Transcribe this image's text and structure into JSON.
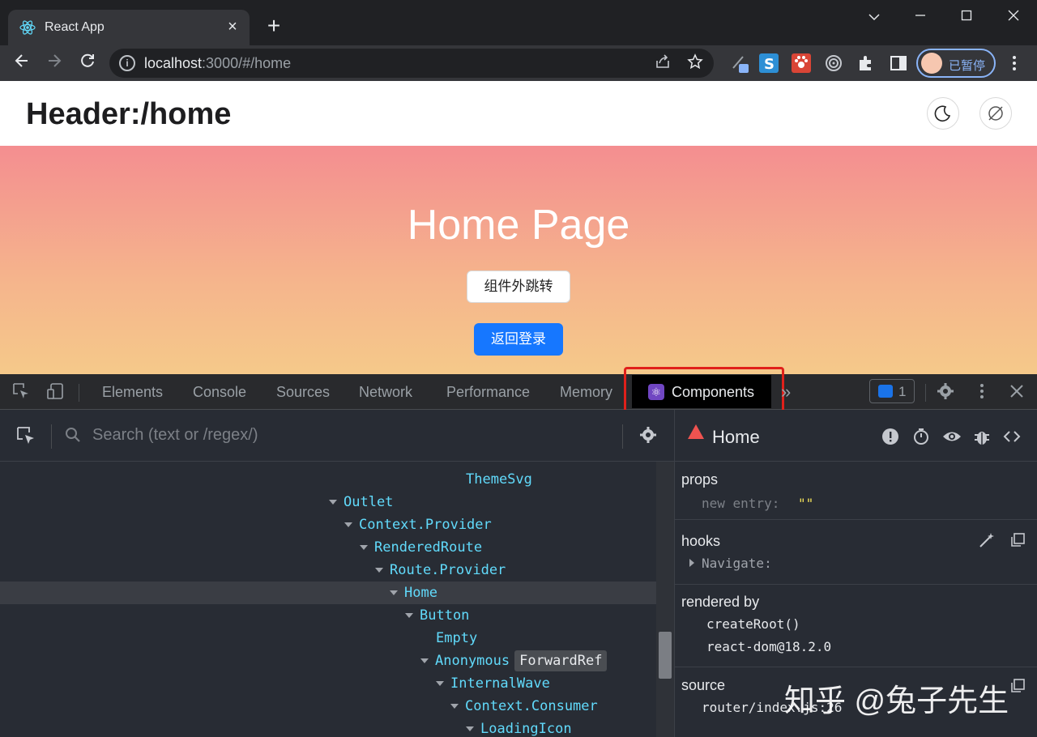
{
  "browser": {
    "tab_title": "React App",
    "tab_close": "×",
    "new_tab": "+",
    "url_host": "localhost",
    "url_rest": ":3000/#/home",
    "profile_label": "已暂停",
    "window_controls": [
      "chevron-down",
      "minimize",
      "maximize",
      "close"
    ]
  },
  "app": {
    "header_title": "Header:/home",
    "hero_title": "Home Page",
    "outer_jump_button": "组件外跳转",
    "back_login_button": "返回登录",
    "hero_gradient": [
      "#f48e90",
      "#f5c98a"
    ],
    "primary_color": "#1677ff"
  },
  "devtools": {
    "tabs": [
      "Elements",
      "Console",
      "Sources",
      "Network",
      "Performance",
      "Memory"
    ],
    "active_tab": "Components",
    "more": "»",
    "issues_count": "1",
    "search_placeholder": "Search (text or /regex/)",
    "tree": [
      {
        "label": "ThemeSvg",
        "expanded": false
      },
      {
        "label": "Outlet",
        "expanded": true
      },
      {
        "label": "Context.Provider",
        "expanded": true
      },
      {
        "label": "RenderedRoute",
        "expanded": true
      },
      {
        "label": "Route.Provider",
        "expanded": true
      },
      {
        "label": "Home",
        "expanded": true,
        "selected": true
      },
      {
        "label": "Button",
        "expanded": true
      },
      {
        "label": "Empty",
        "expanded": false
      },
      {
        "label": "Anonymous",
        "badge": "ForwardRef",
        "expanded": true
      },
      {
        "label": "InternalWave",
        "expanded": true
      },
      {
        "label": "Context.Consumer",
        "expanded": true
      },
      {
        "label": "LoadingIcon",
        "expanded": true
      }
    ],
    "inspector": {
      "component": "Home",
      "props_title": "props",
      "props_key": "new entry",
      "props_value": "\"\"",
      "hooks_title": "hooks",
      "hook_name": "Navigate",
      "rendered_by_title": "rendered by",
      "rendered_by": [
        "createRoot()",
        "react-dom@18.2.0"
      ],
      "source_title": "source",
      "source_value": "router/index.js:26"
    }
  },
  "watermark": "知乎 @兔子先生"
}
